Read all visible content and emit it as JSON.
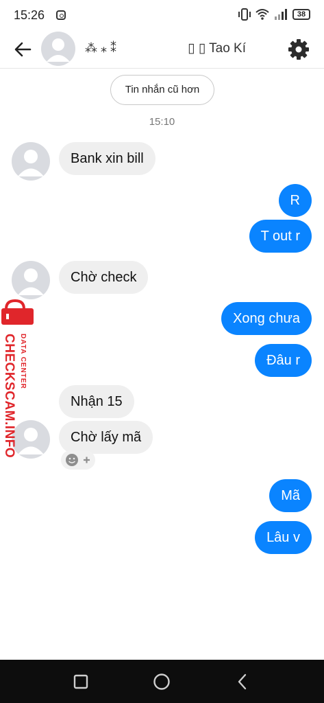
{
  "status": {
    "time": "15:26",
    "battery": "38"
  },
  "header": {
    "contact_name": "⁂ ⁎ ⁑",
    "title": "▯ ▯ Tao Kí"
  },
  "older_messages_label": "Tin nhắn cũ hơn",
  "timestamp": "15:10",
  "messages": [
    {
      "dir": "in",
      "text": "Bank xin bill"
    },
    {
      "dir": "out",
      "text": "R"
    },
    {
      "dir": "out",
      "text": "T out r"
    },
    {
      "dir": "in",
      "text": "Chờ check"
    },
    {
      "dir": "out",
      "text": "Xong chưa"
    },
    {
      "dir": "out",
      "text": "Đâu r"
    },
    {
      "dir": "in",
      "text": "Nhận 15"
    },
    {
      "dir": "in",
      "text": "Chờ lấy mã"
    },
    {
      "dir": "out",
      "text": "Mã"
    },
    {
      "dir": "out",
      "text": "Lâu v"
    }
  ],
  "watermark": {
    "brand": "CHECKSCAM.INFO",
    "tagline": "DATA CENTER"
  },
  "colors": {
    "outgoing": "#0a84ff",
    "incoming": "#efefef",
    "watermark": "#e0262b"
  },
  "icons": [
    "back-arrow-icon",
    "gear-icon",
    "smiley-add-icon",
    "square-icon",
    "circle-icon",
    "triangle-back-icon"
  ]
}
